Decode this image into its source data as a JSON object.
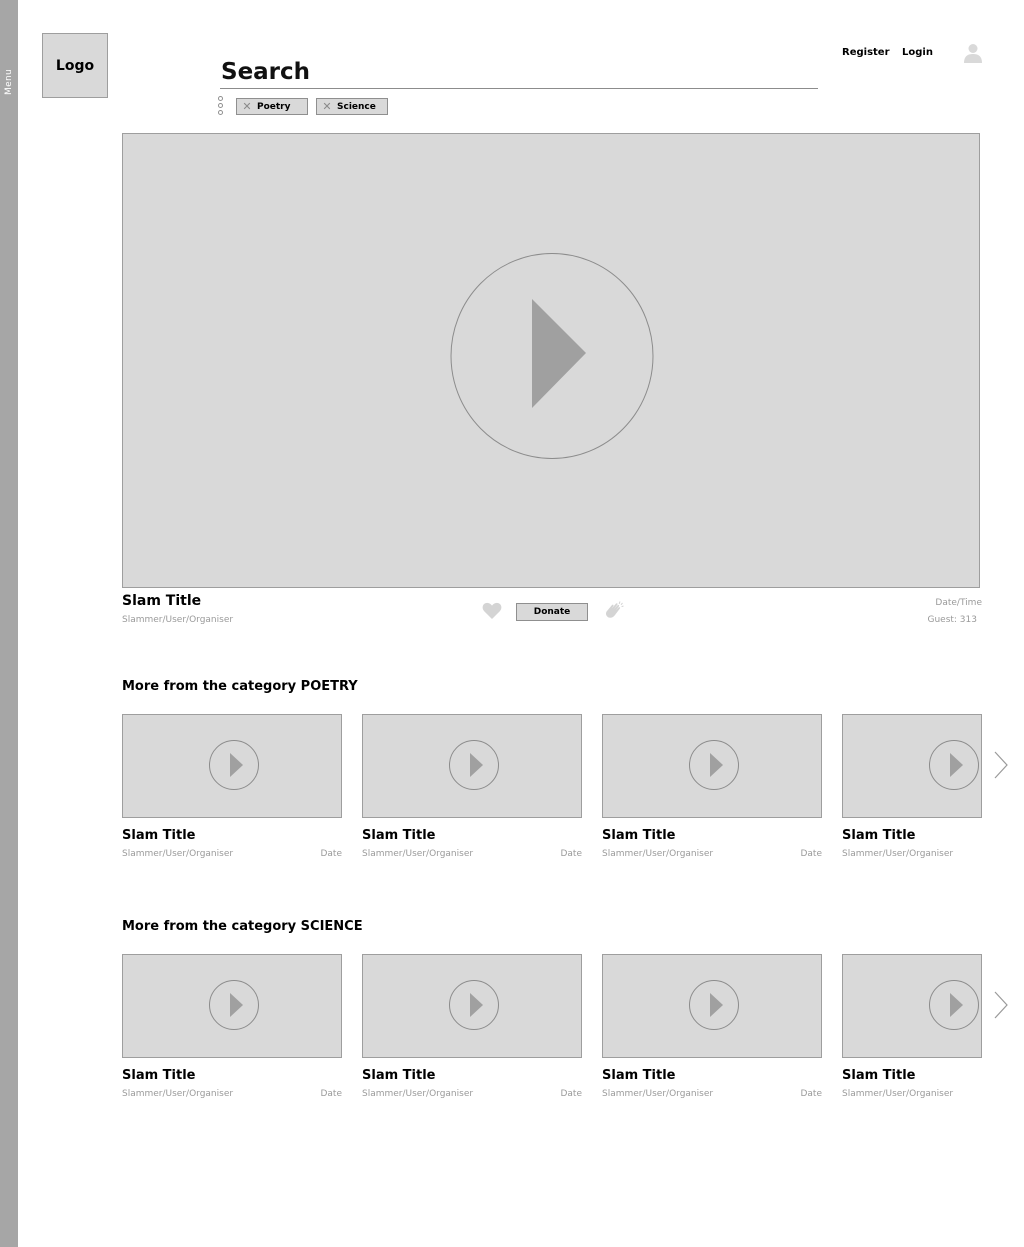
{
  "side_menu": {
    "label": "Menu"
  },
  "logo": {
    "text": "Logo"
  },
  "search": {
    "placeholder": "Search",
    "value": ""
  },
  "filters": [
    {
      "label": "Poetry"
    },
    {
      "label": "Science"
    }
  ],
  "header": {
    "register": "Register",
    "login": "Login"
  },
  "featured": {
    "title": "Slam Title",
    "subtitle": "Slammer/User/Organiser",
    "donate": "Donate",
    "datetime": "Date/Time",
    "guests": "Guest: 313"
  },
  "sections": [
    {
      "title": "More from the category POETRY",
      "cards": [
        {
          "title": "Slam Title",
          "subtitle": "Slammer/User/Organiser",
          "date": "Date"
        },
        {
          "title": "Slam Title",
          "subtitle": "Slammer/User/Organiser",
          "date": "Date"
        },
        {
          "title": "Slam Title",
          "subtitle": "Slammer/User/Organiser",
          "date": "Date"
        },
        {
          "title": "Slam Title",
          "subtitle": "Slammer/User/Organiser",
          "date": ""
        }
      ]
    },
    {
      "title": "More from the category SCIENCE",
      "cards": [
        {
          "title": "Slam Title",
          "subtitle": "Slammer/User/Organiser",
          "date": "Date"
        },
        {
          "title": "Slam Title",
          "subtitle": "Slammer/User/Organiser",
          "date": "Date"
        },
        {
          "title": "Slam Title",
          "subtitle": "Slammer/User/Organiser",
          "date": "Date"
        },
        {
          "title": "Slam Title",
          "subtitle": "Slammer/User/Organiser",
          "date": ""
        }
      ]
    }
  ],
  "icons": {
    "play": "play-icon",
    "heart": "heart-icon",
    "clap": "clap-icon",
    "user": "user-icon",
    "close": "close-icon",
    "next": "chevron-right-icon",
    "more": "more-options-icon"
  },
  "colors": {
    "placeholder_fill": "#d9d9d9",
    "menu_bar": "#a6a6a6",
    "muted_text": "#9a9a9a",
    "icon_gray": "#a0a0a0"
  }
}
